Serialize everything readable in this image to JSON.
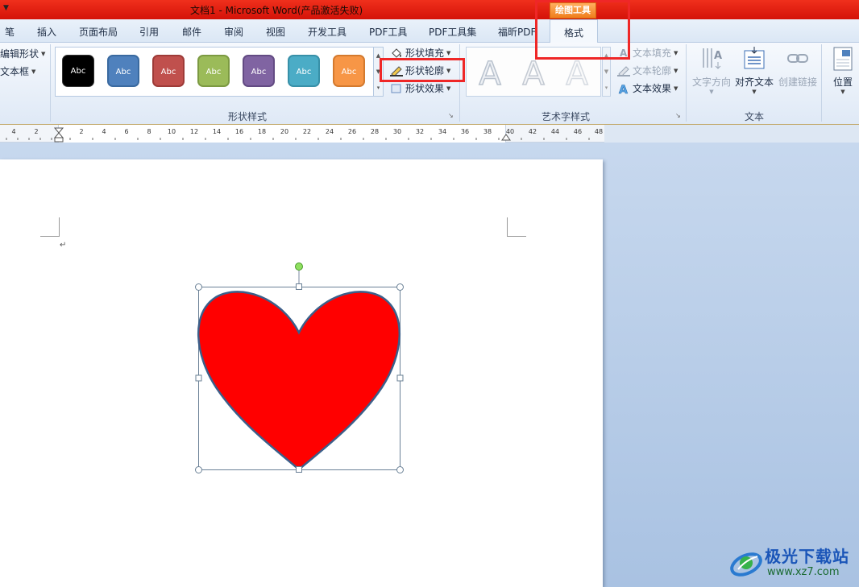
{
  "window": {
    "title": "文档1 - Microsoft Word(产品激活失败)",
    "context_tab_group": "绘图工具"
  },
  "tabs": [
    "笔",
    "插入",
    "页面布局",
    "引用",
    "邮件",
    "审阅",
    "视图",
    "开发工具",
    "PDF工具",
    "PDF工具集",
    "福昕PDF",
    "格式"
  ],
  "active_tab": "格式",
  "ribbon": {
    "left_partial": {
      "edit_shape": "编辑形状",
      "text_box": "文本框"
    },
    "shape_styles": {
      "group_label": "形状样式",
      "gallery_items": [
        {
          "label": "Abc",
          "color": "#000000"
        },
        {
          "label": "Abc",
          "color": "#4f81bd"
        },
        {
          "label": "Abc",
          "color": "#c0504d"
        },
        {
          "label": "Abc",
          "color": "#9bbb59"
        },
        {
          "label": "Abc",
          "color": "#8064a2"
        },
        {
          "label": "Abc",
          "color": "#4bacc6"
        },
        {
          "label": "Abc",
          "color": "#f79646"
        }
      ],
      "shape_fill": "形状填充",
      "shape_outline": "形状轮廓",
      "shape_effects": "形状效果"
    },
    "wordart_styles": {
      "group_label": "艺术字样式",
      "text_fill": "文本填充",
      "text_outline": "文本轮廓",
      "text_effects": "文本效果"
    },
    "text": {
      "group_label": "文本",
      "text_direction": "文字方向",
      "align_text": "对齐文本",
      "create_link": "创建链接"
    },
    "position": "位置"
  },
  "ruler": {
    "labels": [
      "4",
      "2",
      "2",
      "4",
      "6",
      "8",
      "10",
      "12",
      "14",
      "16",
      "18",
      "20",
      "22",
      "24",
      "26",
      "28",
      "30",
      "32",
      "34",
      "36",
      "38",
      "40",
      "42",
      "44",
      "46",
      "48"
    ]
  },
  "document": {
    "paragraph_mark": "↵",
    "shape": "heart",
    "shape_fill": "#ff0000",
    "shape_outline": "#3b5f8a"
  },
  "watermark": {
    "title": "极光下载站",
    "url": "www.xz7.com"
  },
  "highlight_color": "#ef2727"
}
